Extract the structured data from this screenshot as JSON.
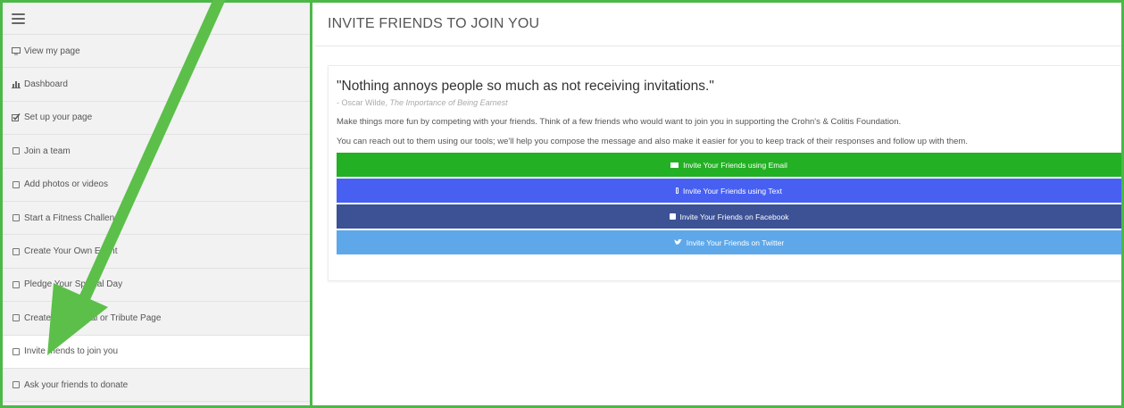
{
  "sidebar": {
    "items": [
      {
        "label": "View my page",
        "icon": "monitor-icon"
      },
      {
        "label": "Dashboard",
        "icon": "bar-chart-icon"
      },
      {
        "label": "Set up your page",
        "icon": "checked-box-icon"
      },
      {
        "label": "Join a team",
        "icon": "checkbox-icon"
      },
      {
        "label": "Add photos or videos",
        "icon": "checkbox-icon"
      },
      {
        "label": "Start a Fitness Challenge",
        "icon": "checkbox-icon"
      },
      {
        "label": "Create Your Own Event",
        "icon": "checkbox-icon"
      },
      {
        "label": "Pledge Your Special Day",
        "icon": "checkbox-icon"
      },
      {
        "label": "Create a Memorial or Tribute Page",
        "icon": "checkbox-icon"
      },
      {
        "label": "Invite friends to join you",
        "icon": "checkbox-icon",
        "active": true
      },
      {
        "label": "Ask your friends to donate",
        "icon": "checkbox-icon"
      }
    ]
  },
  "main": {
    "title": "INVITE FRIENDS TO JOIN YOU",
    "quote": "\"Nothing annoys people so much as not receiving invitations.\"",
    "quote_author": "- Oscar Wilde,",
    "quote_source": "The Importance of Being Earnest",
    "desc1": "Make things more fun by competing with your friends. Think of a few friends who would want to join you in supporting the Crohn's & Colitis Foundation.",
    "desc2": "You can reach out to them using our tools; we'll help you compose the message and also make it easier for you to keep track of their responses and follow up with them.",
    "buttons": {
      "email": "Invite Your Friends using Email",
      "text": "Invite Your Friends using Text",
      "facebook": "Invite Your Friends on Facebook",
      "twitter": "Invite Your Friends on Twitter"
    }
  },
  "colors": {
    "frame": "#4cb848",
    "email": "#23b024",
    "text": "#4760f2",
    "facebook": "#3c5295",
    "twitter": "#5ea8ea",
    "arrow": "#5cbf4a"
  }
}
